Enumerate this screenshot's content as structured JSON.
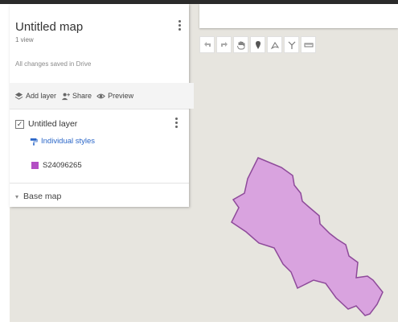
{
  "panel": {
    "title": "Untitled map",
    "views": "1 view",
    "saved_status": "All changes saved in Drive"
  },
  "actions": {
    "add_layer": "Add layer",
    "share": "Share",
    "preview": "Preview"
  },
  "layer": {
    "name": "Untitled layer",
    "checked": true,
    "styles_link": "Individual styles",
    "feature_name": "S24096265",
    "feature_color": "#b34fc4"
  },
  "basemap": {
    "label": "Base map"
  },
  "toolbar": {
    "tools": [
      "undo-icon",
      "redo-icon",
      "hand-icon",
      "marker-icon",
      "draw-line-icon",
      "route-icon",
      "ruler-icon"
    ]
  },
  "colors": {
    "map_background": "#e7e5df",
    "polygon_fill": "#d9a3df",
    "polygon_stroke": "#8e4a9a"
  }
}
